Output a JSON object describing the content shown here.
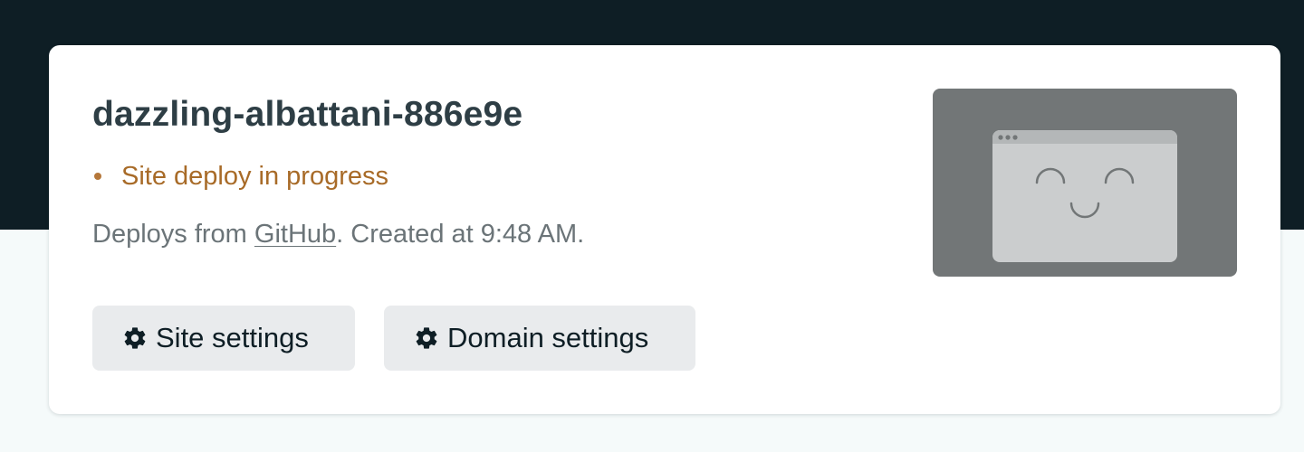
{
  "site": {
    "name": "dazzling-albattani-886e9e",
    "status": "Site deploy in progress",
    "status_color": "#a86b28",
    "deploy_prefix": "Deploys from ",
    "deploy_link": "GitHub",
    "deploy_suffix": ". Created at 9:48 AM."
  },
  "actions": {
    "site_settings_label": "Site settings",
    "site_settings_icon": "gear-icon",
    "domain_settings_label": "Domain settings",
    "domain_settings_icon": "gear-icon"
  },
  "preview": {
    "icon": "smiling-browser-window-placeholder"
  },
  "colors": {
    "header_band": "#0e1e25",
    "card_background": "#ffffff",
    "button_background": "#e9ebed",
    "preview_background": "#727677"
  }
}
